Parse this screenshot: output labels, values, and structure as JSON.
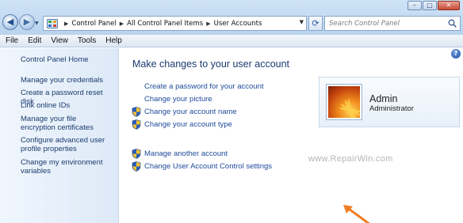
{
  "window": {
    "controls": {
      "minimize": "–",
      "maximize": "□",
      "close": "✕"
    }
  },
  "navigation": {
    "back_glyph": "◀",
    "forward_glyph": "▶",
    "breadcrumbs": [
      "Control Panel",
      "All Control Panel Items",
      "User Accounts"
    ],
    "refresh_glyph": "⟳",
    "search_placeholder": "Search Control Panel"
  },
  "menu": [
    "File",
    "Edit",
    "View",
    "Tools",
    "Help"
  ],
  "sidebar": {
    "home": "Control Panel Home",
    "links": [
      "Manage your credentials",
      "Create a password reset disk",
      "Link online IDs",
      "Manage your file encryption certificates",
      "Configure advanced user profile properties",
      "Change my environment variables"
    ]
  },
  "main": {
    "title": "Make changes to your user account",
    "tasks": [
      {
        "label": "Create a password for your account",
        "shield": false
      },
      {
        "label": "Change your picture",
        "shield": false
      },
      {
        "label": "Change your account name",
        "shield": true
      },
      {
        "label": "Change your account type",
        "shield": true
      },
      {
        "label": "Manage another account",
        "shield": true
      },
      {
        "label": "Change User Account Control settings",
        "shield": true
      }
    ],
    "help_glyph": "?"
  },
  "user": {
    "name": "Admin",
    "role": "Administrator"
  },
  "watermark": "www.RepairWin.com",
  "colors": {
    "link": "#1f4a9c",
    "title": "#1d3a6e",
    "arrow": "#f07e26"
  }
}
